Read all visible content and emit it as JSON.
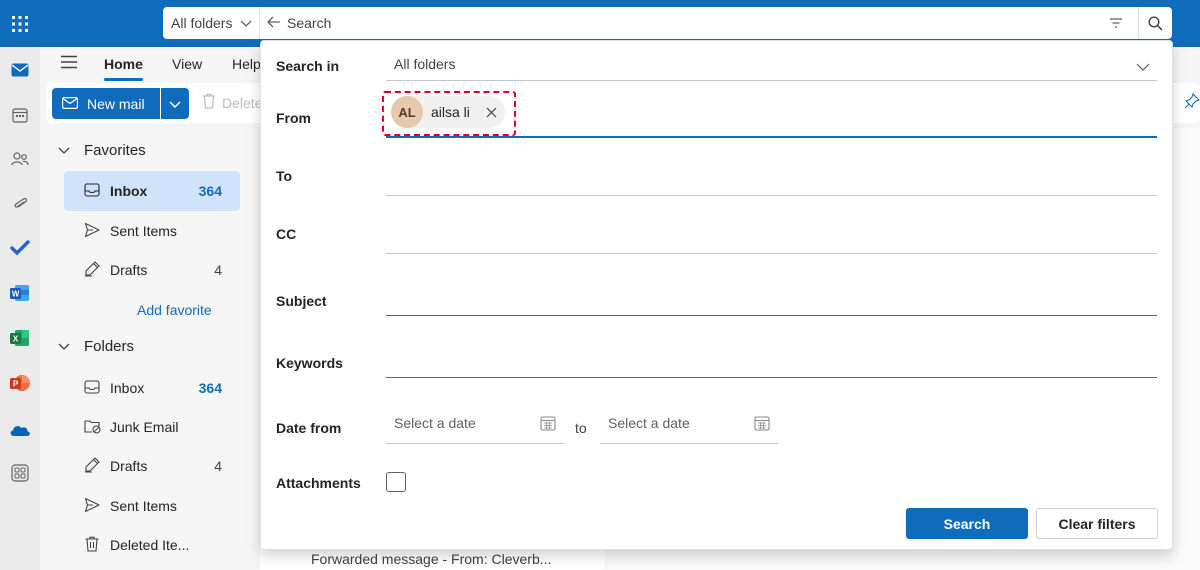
{
  "topbar": {
    "waffle_icon": "app-launcher-icon",
    "search_scope": "All folders",
    "search_placeholder": "Search",
    "brand_color": "#0f6cbd"
  },
  "rail": {
    "apps": [
      "mail-icon",
      "calendar-icon",
      "people-icon",
      "attachments-icon",
      "todo-icon",
      "word-icon",
      "excel-icon",
      "powerpoint-icon",
      "onedrive-icon",
      "more-apps-icon"
    ]
  },
  "ribbon": {
    "tabs": [
      {
        "label": "Home",
        "active": true
      },
      {
        "label": "View"
      },
      {
        "label": "Help"
      }
    ],
    "new_mail": "New mail",
    "delete": "Delete"
  },
  "folders": {
    "favorites_header": "Favorites",
    "favorites": [
      {
        "label": "Inbox",
        "count": "364",
        "icon": "inbox-icon",
        "selected": true
      },
      {
        "label": "Sent Items",
        "count": "",
        "icon": "send-icon"
      },
      {
        "label": "Drafts",
        "count": "4",
        "icon": "drafts-icon"
      }
    ],
    "add_favorite": "Add favorite",
    "folders_header": "Folders",
    "folder_items": [
      {
        "label": "Inbox",
        "count": "364",
        "icon": "inbox-icon"
      },
      {
        "label": "Junk Email",
        "count": "",
        "icon": "junk-icon"
      },
      {
        "label": "Drafts",
        "count": "4",
        "icon": "drafts-icon"
      },
      {
        "label": "Sent Items",
        "count": "",
        "icon": "send-icon"
      },
      {
        "label": "Deleted Ite...",
        "count": "",
        "icon": "trash-icon"
      }
    ]
  },
  "message_list": {
    "peek_preview": "Forwarded message - From: Cleverb..."
  },
  "search_panel": {
    "search_in_label": "Search in",
    "search_in_value": "All folders",
    "from_label": "From",
    "from_chip": {
      "initials": "AL",
      "name": "ailsa li"
    },
    "to_label": "To",
    "cc_label": "CC",
    "subject_label": "Subject",
    "keywords_label": "Keywords",
    "date_from_label": "Date from",
    "date_from_placeholder": "Select a date",
    "date_to_word": "to",
    "date_to_placeholder": "Select a date",
    "attachments_label": "Attachments",
    "attachments_checked": false,
    "search_button": "Search",
    "clear_button": "Clear filters"
  }
}
